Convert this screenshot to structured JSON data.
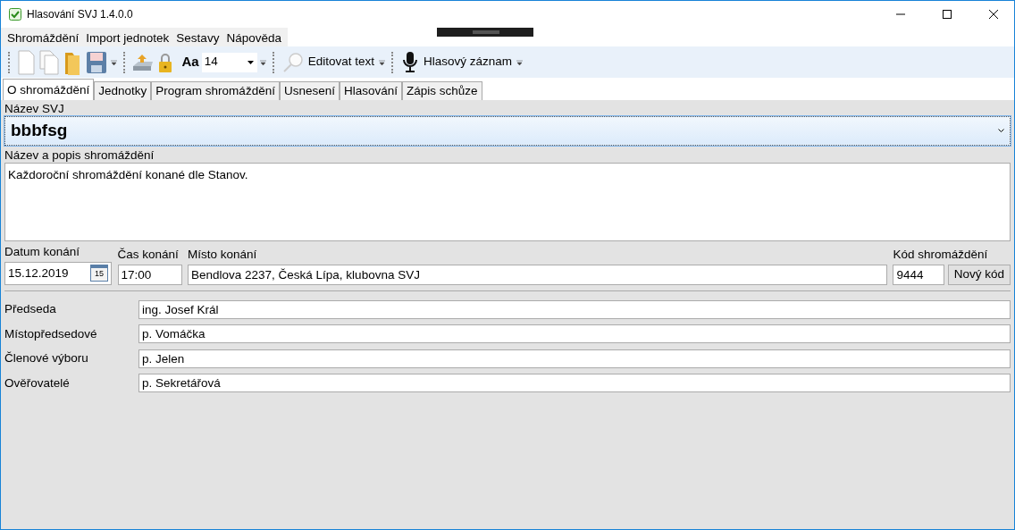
{
  "window": {
    "title": "Hlasování SVJ 1.4.0.0"
  },
  "menu": [
    "Shromáždění",
    "Import jednotek",
    "Sestavy",
    "Nápověda"
  ],
  "toolbar": {
    "font_label": "Aa",
    "font_size": "14",
    "edit_button": "Editovat text",
    "voice_button": "Hlasový záznam"
  },
  "tabs": [
    {
      "label": "O shromáždění",
      "selected": true
    },
    {
      "label": "Jednotky",
      "selected": false
    },
    {
      "label": "Program shromáždění",
      "selected": false
    },
    {
      "label": "Usnesení",
      "selected": false
    },
    {
      "label": "Hlasování",
      "selected": false
    },
    {
      "label": "Zápis schůze",
      "selected": false
    }
  ],
  "svj": {
    "label": "Název SVJ",
    "value": "bbbfsg"
  },
  "description": {
    "label": "Název a popis shromáždění",
    "value": "Každoroční shromáždění konané dle Stanov."
  },
  "date": {
    "label": "Datum konání",
    "value": "15.12.2019",
    "icon_day": "15"
  },
  "time": {
    "label": "Čas konání",
    "value": "17:00"
  },
  "place": {
    "label": "Místo konání",
    "value": "Bendlova 2237, Česká Lípa, klubovna SVJ"
  },
  "code": {
    "label": "Kód shromáždění",
    "value": "9444",
    "button": "Nový kód"
  },
  "people": [
    {
      "label": "Předseda",
      "value": "ing. Josef Král"
    },
    {
      "label": "Místopředsedové",
      "value": "p. Vomáčka"
    },
    {
      "label": "Členové výboru",
      "value": "p. Jelen"
    },
    {
      "label": "Ověřovatelé",
      "value": "p. Sekretářová"
    }
  ]
}
